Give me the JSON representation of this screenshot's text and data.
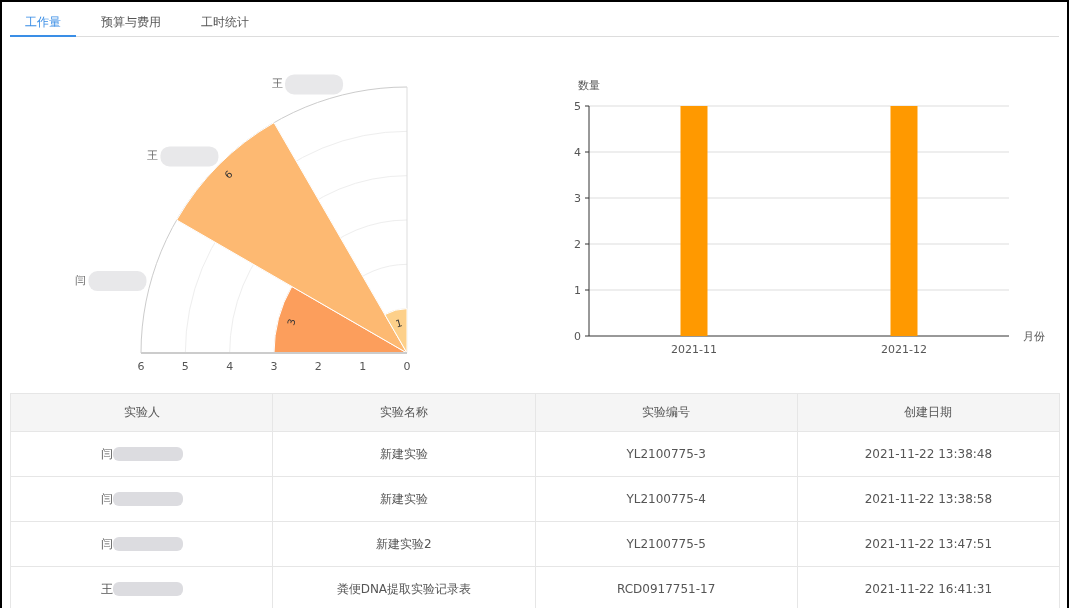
{
  "tabs": [
    {
      "label": "工作量",
      "selected": true
    },
    {
      "label": "预算与费用",
      "selected": false
    },
    {
      "label": "工时统计",
      "selected": false
    }
  ],
  "polar_chart": {
    "sectors": [
      {
        "label": "闫",
        "value_label": "3",
        "level": 0.5
      },
      {
        "label": "王",
        "value_label": "6",
        "level": 1
      },
      {
        "label": "王",
        "value_label": "1",
        "level": 0.1667
      }
    ],
    "radial_tick_labels": [
      "6",
      "5",
      "4",
      "3",
      "2",
      "1",
      "0"
    ]
  },
  "bar_chart": {
    "chart_data": {
      "type": "bar",
      "ylabel": "数量",
      "xlabel": "月份",
      "categories": [
        "2021-11",
        "2021-12"
      ],
      "values": [
        5,
        5
      ],
      "ylim": [
        0,
        5
      ],
      "yticks": [
        0,
        1,
        2,
        3,
        4,
        5
      ],
      "grid": true
    }
  },
  "table": {
    "columns": [
      "实验人",
      "实验名称",
      "实验编号",
      "创建日期"
    ],
    "rows": [
      [
        "闫",
        "新建实验",
        "YL2100775-3",
        "2021-11-22 13:38:48"
      ],
      [
        "闫",
        "新建实验",
        "YL2100775-4",
        "2021-11-22 13:38:58"
      ],
      [
        "闫",
        "新建实验2",
        "YL2100775-5",
        "2021-11-22 13:47:51"
      ],
      [
        "王",
        "粪便DNA提取实验记录表",
        "RCD0917751-17",
        "2021-11-22 16:41:31"
      ]
    ]
  }
}
